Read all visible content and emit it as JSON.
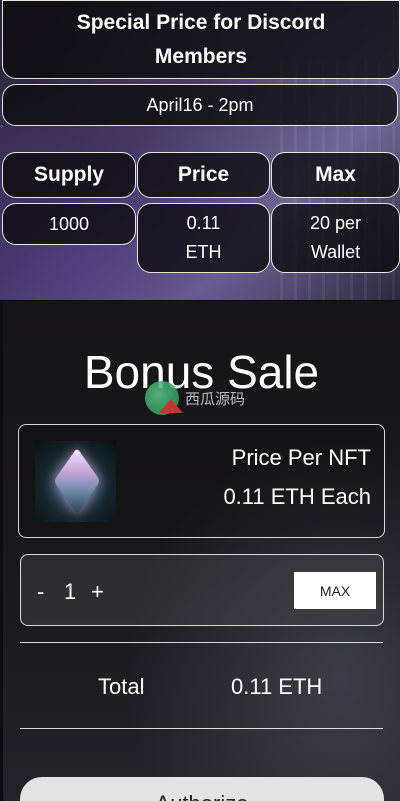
{
  "banner": {
    "title": "Special Price for Discord Members",
    "date": "April16 - 2pm",
    "headers": [
      "Supply",
      "Price",
      "Max"
    ],
    "values": [
      "1000",
      "0.11 ETH",
      "20 per Wallet"
    ]
  },
  "sale": {
    "title": "Bonus Sale",
    "watermark_text": "西瓜源码",
    "price_label": "Price Per NFT",
    "price_value": "0.11 ETH Each",
    "minus_label": "-",
    "quantity": "1",
    "plus_label": "+",
    "max_label": "MAX",
    "total_label": "Total",
    "total_value": "0.11 ETH",
    "action_label": "Authorize"
  }
}
